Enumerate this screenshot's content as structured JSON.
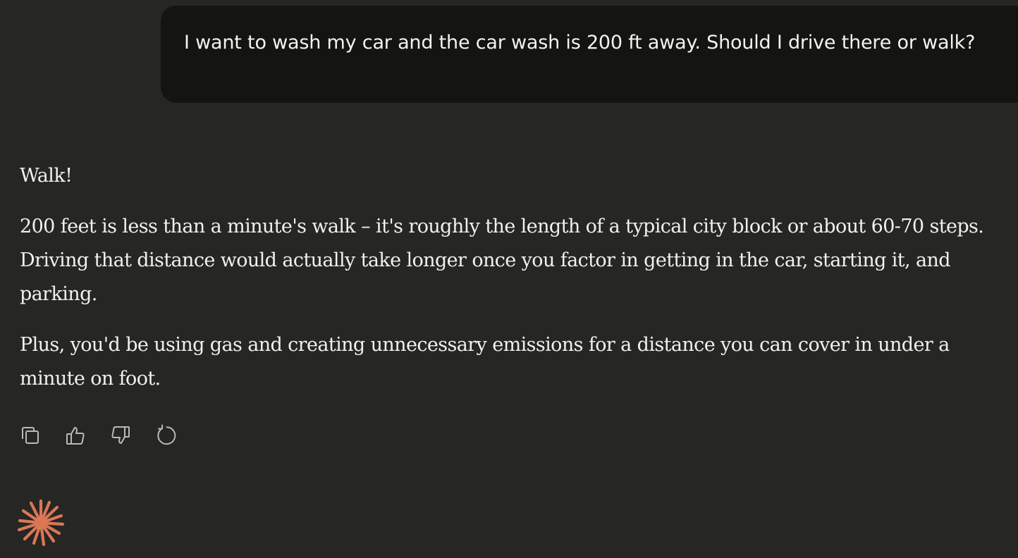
{
  "conversation": {
    "user_message": "I want to wash my car and the car wash is 200 ft away. Should I drive there or walk?",
    "assistant_paragraphs": [
      "Walk!",
      "200 feet is less than a minute's walk – it's roughly the length of a typical city block or about 60-70 steps. Driving that distance would actually take longer once you factor in getting in the car, starting it, and parking.",
      "Plus, you'd be using gas and creating unnecessary emissions for a distance you can cover in under a minute on foot."
    ]
  },
  "actions": {
    "icons": [
      "copy-icon",
      "thumbs-up-icon",
      "thumbs-down-icon",
      "retry-icon"
    ]
  },
  "colors": {
    "background": "#262624",
    "user_bubble": "#141413",
    "text": "#f3f1ea",
    "icon": "#bdbab2",
    "brand_accent": "#d97757"
  },
  "brand": {
    "icon": "spark-icon"
  }
}
